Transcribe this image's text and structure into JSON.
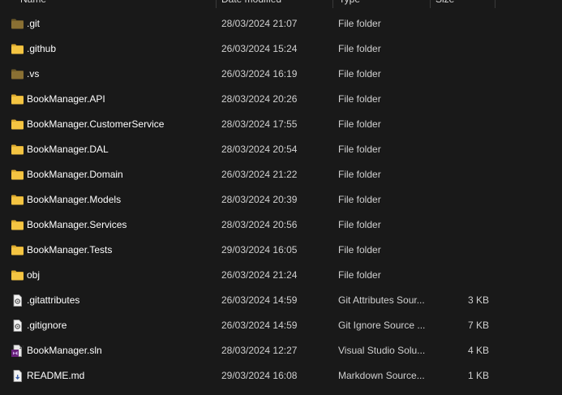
{
  "columns": {
    "name": "Name",
    "date_modified": "Date modified",
    "type": "Type",
    "size": "Size"
  },
  "colors": {
    "background": "#191919",
    "folder": "#f4c442",
    "folder_hidden": "#8a7033"
  },
  "files": [
    {
      "name": ".git",
      "date": "28/03/2024 21:07",
      "type": "File folder",
      "size": "",
      "icon": "folder-hidden-icon"
    },
    {
      "name": ".github",
      "date": "26/03/2024 15:24",
      "type": "File folder",
      "size": "",
      "icon": "folder-icon"
    },
    {
      "name": ".vs",
      "date": "26/03/2024 16:19",
      "type": "File folder",
      "size": "",
      "icon": "folder-hidden-icon"
    },
    {
      "name": "BookManager.API",
      "date": "28/03/2024 20:26",
      "type": "File folder",
      "size": "",
      "icon": "folder-icon"
    },
    {
      "name": "BookManager.CustomerService",
      "date": "28/03/2024 17:55",
      "type": "File folder",
      "size": "",
      "icon": "folder-icon"
    },
    {
      "name": "BookManager.DAL",
      "date": "28/03/2024 20:54",
      "type": "File folder",
      "size": "",
      "icon": "folder-icon"
    },
    {
      "name": "BookManager.Domain",
      "date": "26/03/2024 21:22",
      "type": "File folder",
      "size": "",
      "icon": "folder-icon"
    },
    {
      "name": "BookManager.Models",
      "date": "28/03/2024 20:39",
      "type": "File folder",
      "size": "",
      "icon": "folder-icon"
    },
    {
      "name": "BookManager.Services",
      "date": "28/03/2024 20:56",
      "type": "File folder",
      "size": "",
      "icon": "folder-icon"
    },
    {
      "name": "BookManager.Tests",
      "date": "29/03/2024 16:05",
      "type": "File folder",
      "size": "",
      "icon": "folder-icon"
    },
    {
      "name": "obj",
      "date": "26/03/2024 21:24",
      "type": "File folder",
      "size": "",
      "icon": "folder-icon"
    },
    {
      "name": ".gitattributes",
      "date": "26/03/2024 14:59",
      "type": "Git Attributes Sour...",
      "size": "3 KB",
      "icon": "config-file-icon"
    },
    {
      "name": ".gitignore",
      "date": "26/03/2024 14:59",
      "type": "Git Ignore Source ...",
      "size": "7 KB",
      "icon": "config-file-icon"
    },
    {
      "name": "BookManager.sln",
      "date": "28/03/2024 12:27",
      "type": "Visual Studio Solu...",
      "size": "4 KB",
      "icon": "visual-studio-solution-icon"
    },
    {
      "name": "README.md",
      "date": "29/03/2024 16:08",
      "type": "Markdown Source...",
      "size": "1 KB",
      "icon": "markdown-file-icon"
    }
  ]
}
